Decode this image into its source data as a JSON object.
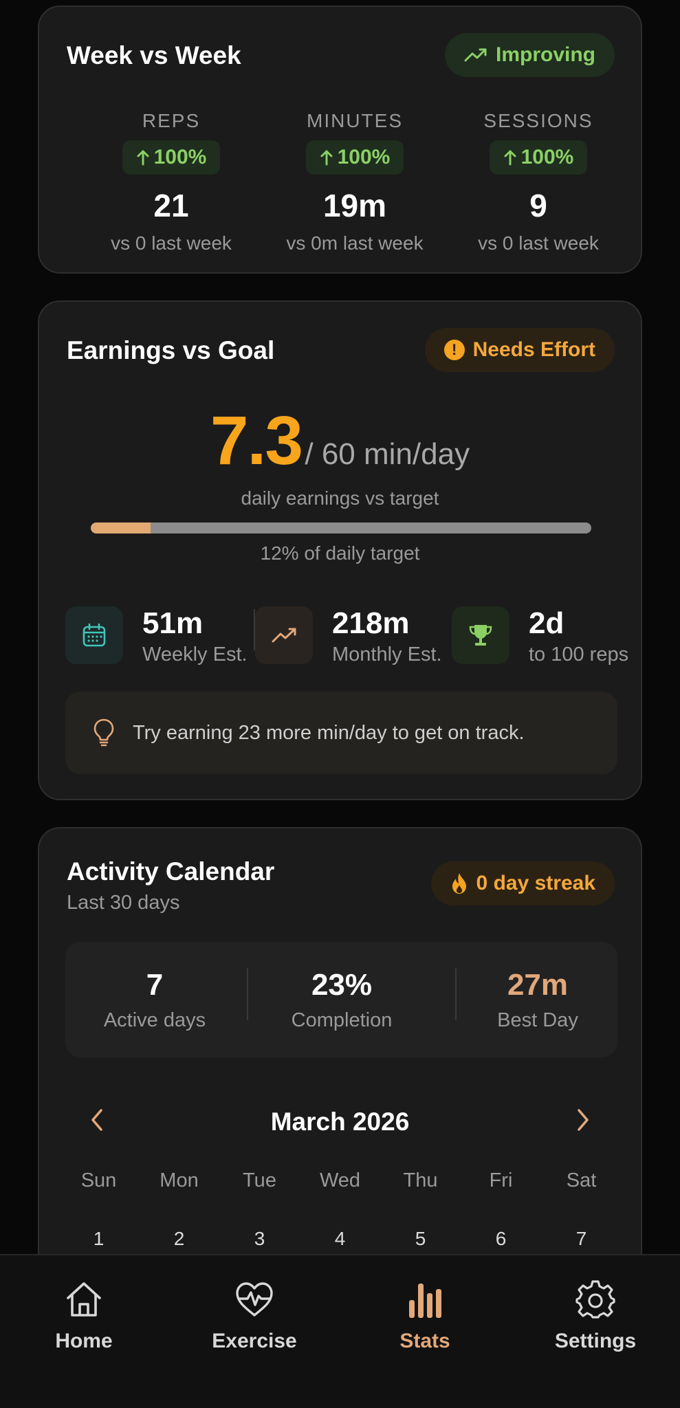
{
  "week": {
    "title": "Week vs Week",
    "badge": "Improving",
    "columns": [
      {
        "label": "REPS",
        "delta": "100%",
        "value": "21",
        "sub": "vs 0 last week"
      },
      {
        "label": "MINUTES",
        "delta": "100%",
        "value": "19m",
        "sub": "vs 0m last week"
      },
      {
        "label": "SESSIONS",
        "delta": "100%",
        "value": "9",
        "sub": "vs 0 last week"
      }
    ]
  },
  "earnings": {
    "title": "Earnings vs Goal",
    "badge": "Needs Effort",
    "badge_glyph": "!",
    "value": "7.3",
    "unit": "/ 60 min/day",
    "subtitle": "daily earnings vs target",
    "progress_percent": 12,
    "progress_label": "12% of daily target",
    "stats": [
      {
        "icon": "calendar-icon",
        "value": "51m",
        "label": "Weekly Est."
      },
      {
        "icon": "trending-up-icon",
        "value": "218m",
        "label": "Monthly Est."
      },
      {
        "icon": "trophy-icon",
        "value": "2d",
        "label": "to 100 reps"
      }
    ],
    "tip": "Try earning 23 more min/day to get on track."
  },
  "calendar": {
    "title": "Activity Calendar",
    "subtitle": "Last 30 days",
    "badge": "0 day streak",
    "summary": [
      {
        "value": "7",
        "label": "Active days"
      },
      {
        "value": "23%",
        "label": "Completion"
      },
      {
        "value": "27m",
        "label": "Best Day"
      }
    ],
    "month": "March 2026",
    "weekdays": [
      "Sun",
      "Mon",
      "Tue",
      "Wed",
      "Thu",
      "Fri",
      "Sat"
    ],
    "days": [
      "1",
      "2",
      "3",
      "4",
      "5",
      "6",
      "7"
    ]
  },
  "nav": [
    {
      "label": "Home",
      "icon": "home-icon"
    },
    {
      "label": "Exercise",
      "icon": "heart-pulse-icon"
    },
    {
      "label": "Stats",
      "icon": "bar-chart-icon",
      "active": true
    },
    {
      "label": "Settings",
      "icon": "gear-icon"
    }
  ],
  "colors": {
    "accent_orange": "#f8a51c",
    "accent_green": "#8bd065",
    "accent_tan": "#e2a87a",
    "background": "#080808",
    "card": "#1b1b1b"
  }
}
